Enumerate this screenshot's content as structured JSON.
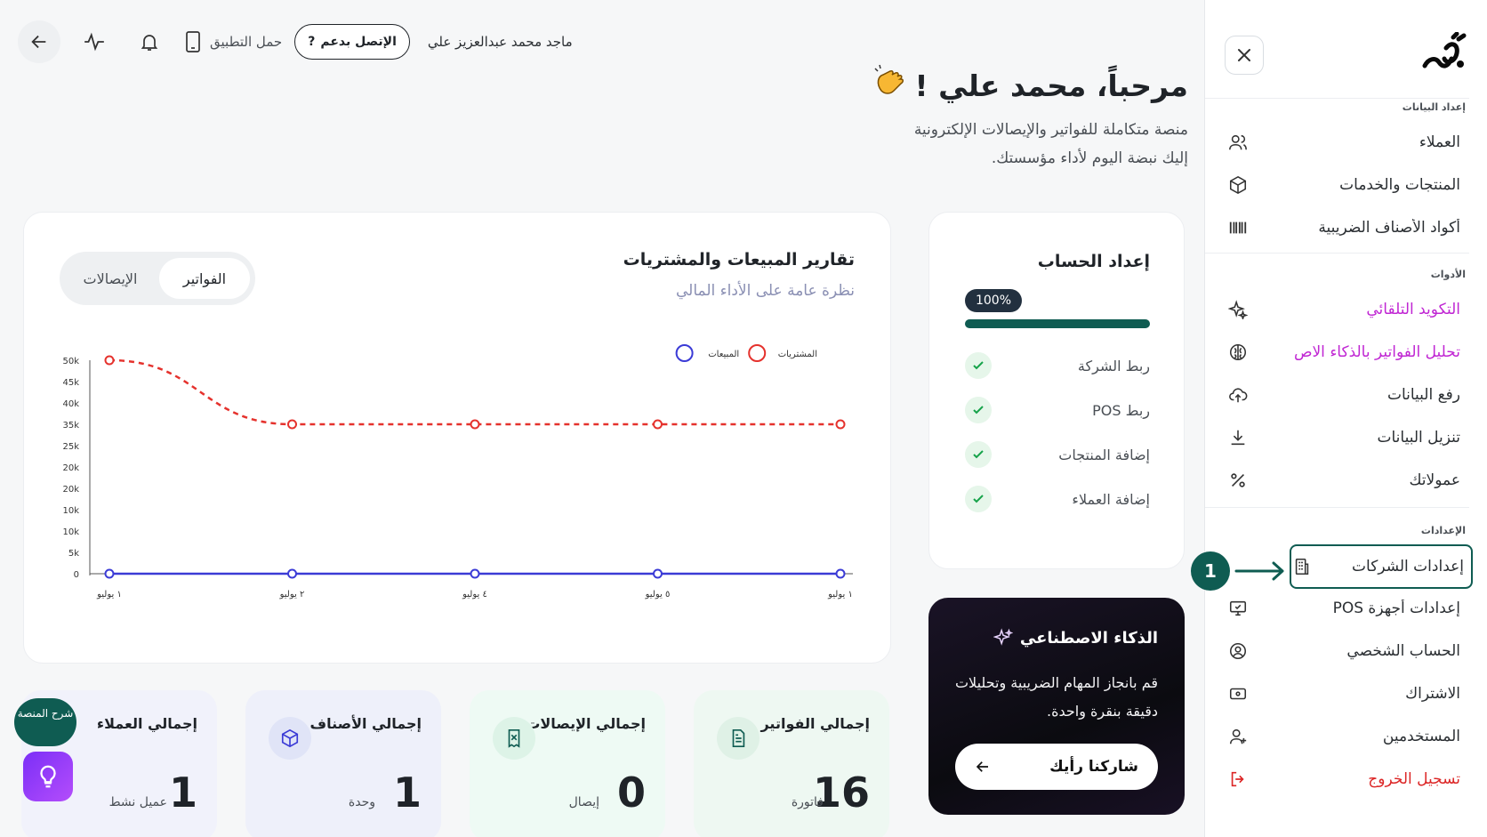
{
  "topbar": {
    "user_name": "ماجد محمد عبدالعزيز علي",
    "support_label": "الإتصل بدعم",
    "download_app": "حمل التطبيق"
  },
  "welcome": {
    "title": "مرحباً، محمد علي !",
    "line1": "منصة متكاملة للفواتير والإيصالات الإلكترونية",
    "line2": "إليك نبضة اليوم لأداء مؤسستك."
  },
  "sidebar": {
    "sections": {
      "data": "إعداد البيانات",
      "tools": "الأدوات",
      "settings": "الإعدادات"
    },
    "items": [
      {
        "label": "العملاء",
        "icon": "users-icon"
      },
      {
        "label": "المنتجات والخدمات",
        "icon": "box-icon"
      },
      {
        "label": "أكواد الأصناف الضريبية",
        "icon": "barcode-icon"
      },
      {
        "label": "التكويد التلقائي",
        "icon": "sparkle-icon"
      },
      {
        "label": "تحليل الفواتير بالذكاء الاص",
        "icon": "brain-icon"
      },
      {
        "label": "رفع البيانات",
        "icon": "upload-icon"
      },
      {
        "label": "تنزيل البيانات",
        "icon": "download-icon"
      },
      {
        "label": "عمولاتك",
        "icon": "percent-icon"
      },
      {
        "label": "إعدادات الشركات",
        "icon": "building-icon"
      },
      {
        "label": "إعدادات أجهزة POS",
        "icon": "monitor-icon"
      },
      {
        "label": "الحساب الشخصي",
        "icon": "user-circle-icon"
      },
      {
        "label": "الاشتراك",
        "icon": "card-icon"
      },
      {
        "label": "المستخدمين",
        "icon": "user-add-icon"
      },
      {
        "label": "تسجيل الخروج",
        "icon": "logout-icon"
      }
    ],
    "callout_number": "1"
  },
  "chart_card": {
    "title": "تقارير المبيعات والمشتريات",
    "subtitle": "نظرة عامة على الأداء المالي",
    "tabs": [
      "الفواتير",
      "الإيصالات"
    ],
    "active_tab": "الفواتير"
  },
  "chart_data": {
    "type": "line",
    "categories": [
      "١ يوليو",
      "٢ يوليو",
      "٤ يوليو",
      "٥ يوليو",
      "١ يوليو"
    ],
    "y_ticks": [
      "0",
      "5k",
      "10k",
      "10k",
      "20k",
      "20k",
      "25k",
      "35k",
      "40k",
      "45k",
      "50k"
    ],
    "series": [
      {
        "name": "المشتريات",
        "values": [
          50000,
          35000,
          35000,
          35000,
          35000
        ],
        "color": "#e5322d",
        "style": "dashed"
      },
      {
        "name": "المبيعات",
        "values": [
          0,
          0,
          0,
          0,
          0
        ],
        "color": "#3b3bd6",
        "style": "solid"
      }
    ],
    "ylim": [
      0,
      50000
    ],
    "legend": "top-right",
    "grid": true
  },
  "setup_card": {
    "title": "إعداد الحساب",
    "progress_label": "100%",
    "progress": 1.0,
    "steps": [
      "ربط الشركة",
      "ربط POS",
      "إضافة المنتجات",
      "إضافة العملاء"
    ]
  },
  "ai_card": {
    "title": "الذكاء الاصطناعي",
    "text": "قم بانجاز المهام الضريبية وتحليلات دقيقة بنقرة واحدة.",
    "button": "شاركنا رأيك"
  },
  "stats": [
    {
      "title": "إجمالي الفواتير",
      "value": "16",
      "unit": "فاتورة",
      "icon": "document-icon",
      "bg": "#eef8f2"
    },
    {
      "title": "إجمالي الإيصالات",
      "value": "0",
      "unit": "إيصال",
      "icon": "receipt-icon",
      "bg": "#eefaf4"
    },
    {
      "title": "إجمالي الأصناف",
      "value": "1",
      "unit": "وحدة",
      "icon": "cube-icon",
      "bg": "#eef0fa"
    },
    {
      "title": "إجمالي العملاء",
      "value": "1",
      "unit": "عميل نشط",
      "icon": "users-icon",
      "bg": "#f1f2fb"
    }
  ],
  "help": {
    "label": "شرح المنصة"
  },
  "colors": {
    "brand": "#0f5c52",
    "purple": "#c026d3",
    "danger": "#dc2626"
  }
}
